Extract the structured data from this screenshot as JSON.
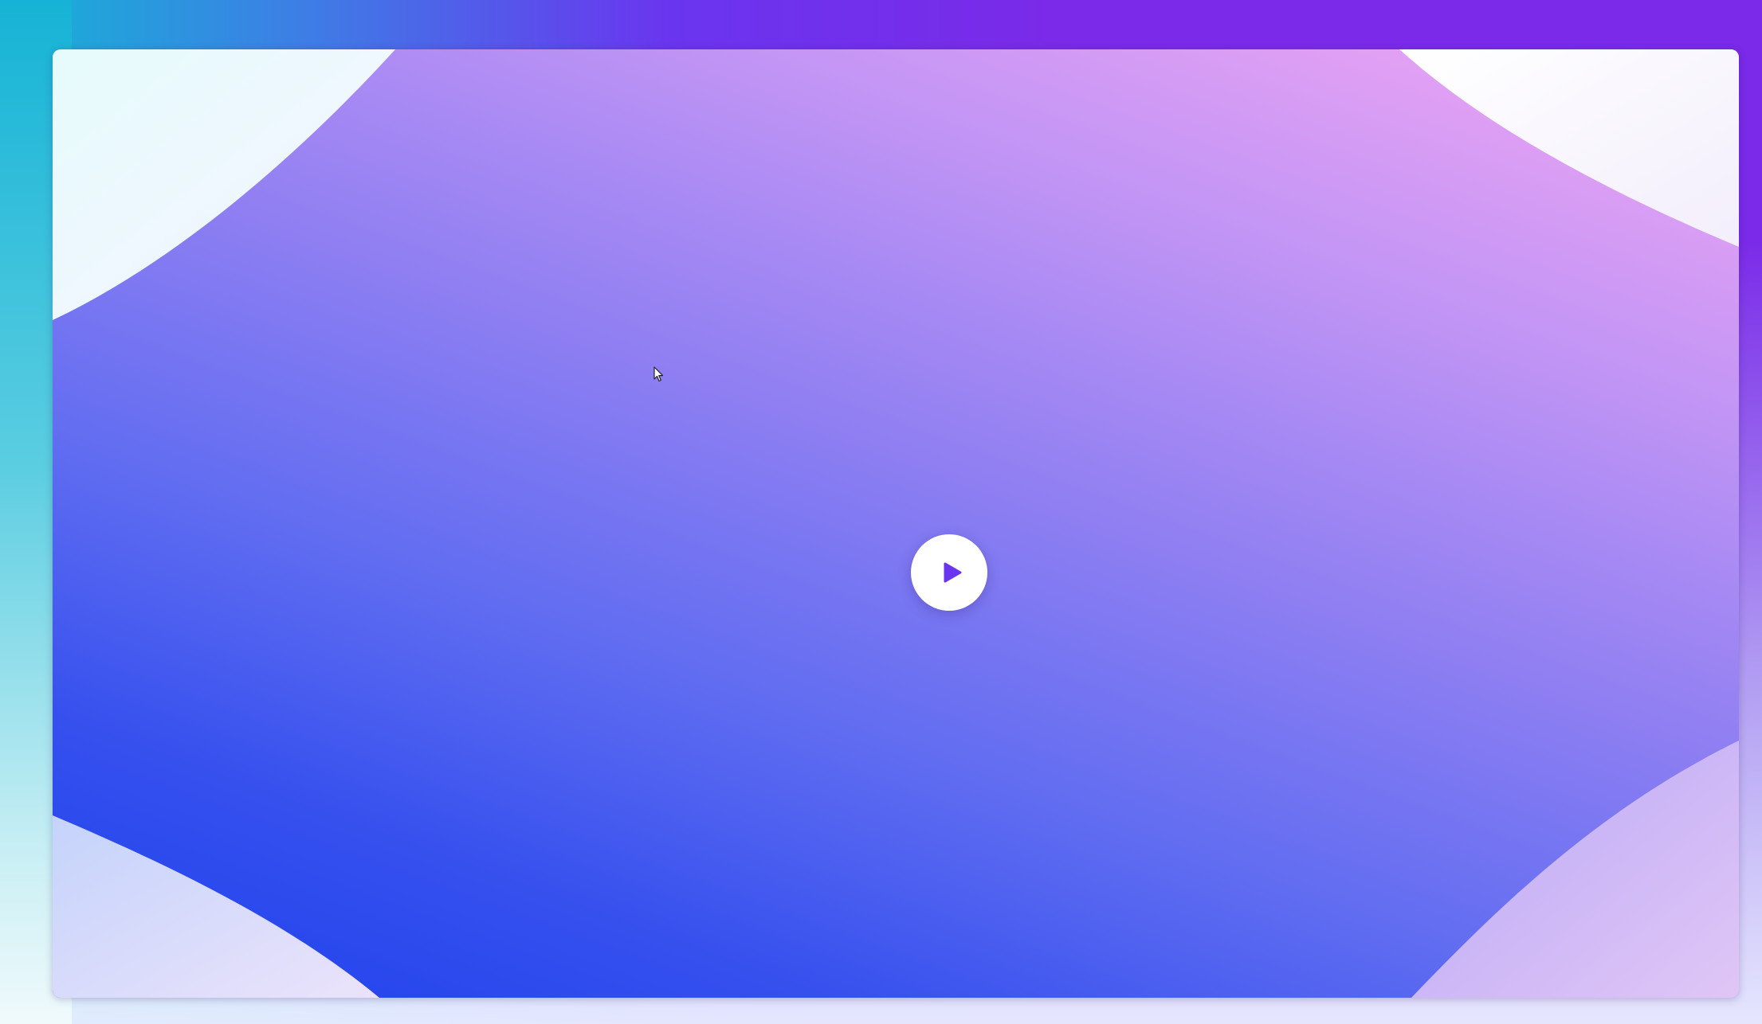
{
  "colors": {
    "outer_gradient_start": "#16b3d6",
    "outer_gradient_end": "#7a2ae8",
    "video_pink": "#f2a6f3",
    "video_violet": "#8f7ff2",
    "video_blue": "#1d41ec",
    "play_button_bg": "#ffffff",
    "play_icon": "#6a35ef"
  },
  "video": {
    "play_icon": "play-icon",
    "corner_button_icon": "magic-wand-icon"
  }
}
